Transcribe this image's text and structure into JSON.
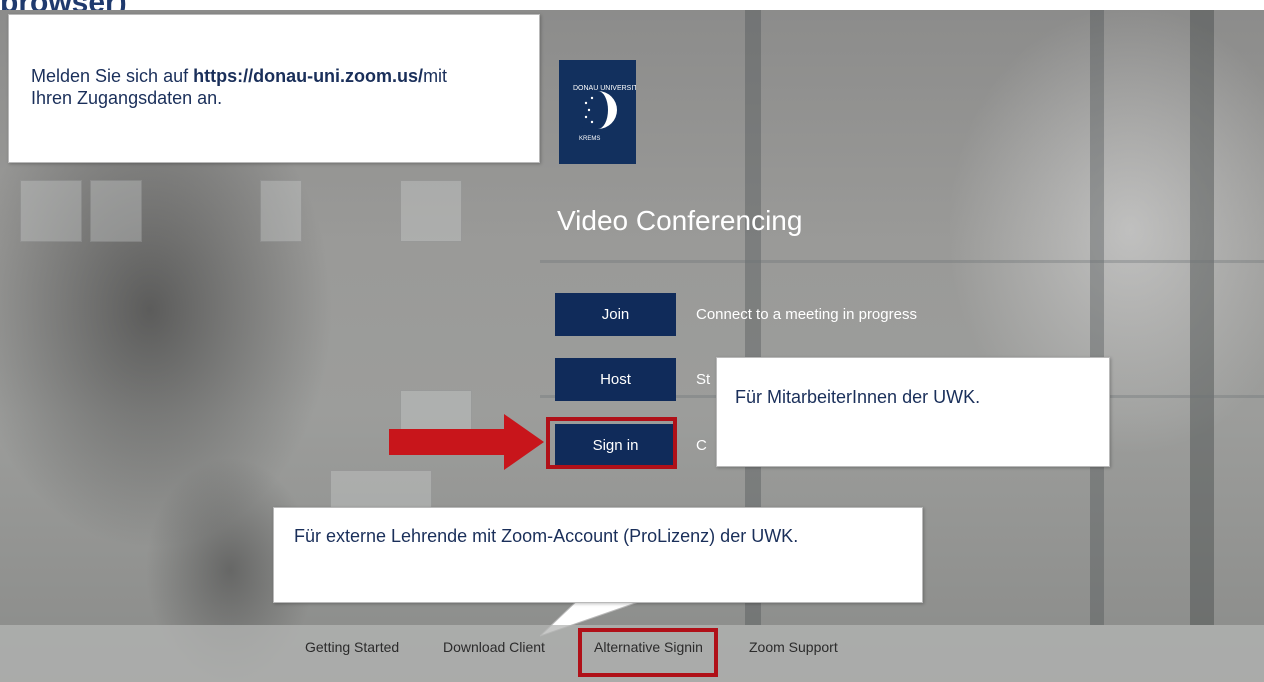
{
  "page_title": "browser)",
  "callout_top": {
    "prefix": "Melden Sie sich auf ",
    "url": "https://donau-uni.zoom.us/",
    "suffix": "mit Ihren Zugangsdaten an."
  },
  "logo": {
    "text_top": "DONAU UNIVERSITÄT",
    "text_bottom": "KREMS",
    "icon": "donau-uni-logo-icon"
  },
  "hero_title": "Video Conferencing",
  "actions": [
    {
      "label": "Join",
      "description": "Connect to a meeting in progress"
    },
    {
      "label": "Host",
      "description": "St"
    },
    {
      "label": "Sign in",
      "description": "C"
    }
  ],
  "callout_staff": "Für MitarbeiterInnen der UWK.",
  "callout_external": "Für externe Lehrende mit Zoom-Account (ProLizenz) der UWK.",
  "footer_links": [
    "Getting Started",
    "Download Client",
    "Alternative Signin",
    "Zoom Support"
  ],
  "colors": {
    "title": "#1f3a6e",
    "button": "#102b5a",
    "highlight": "#b01018",
    "arrow": "#c8151b"
  }
}
